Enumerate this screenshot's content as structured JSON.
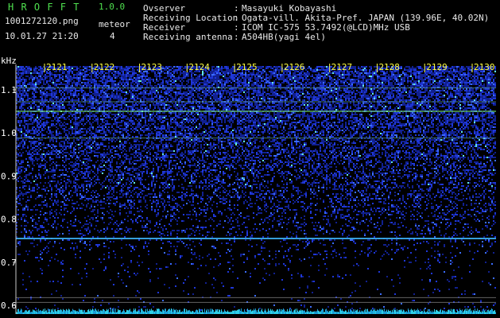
{
  "header": {
    "app_name": "H R O F F T",
    "version": "1.0.0",
    "filename": "1001272120.png",
    "datetime": "10.01.27 21:20",
    "meteor_label": "meteor",
    "meteor_count": "4",
    "info_labels": [
      "Ovserver",
      "Receiving Location",
      "Receiver",
      "Receiving antenna"
    ],
    "info_separators": [
      ":",
      ":",
      ":",
      ":"
    ],
    "info_values": [
      "Masayuki Kobayashi",
      "Ogata-vill. Akita-Pref. JAPAN (139.96E, 40.02N)",
      "ICOM IC-575 53.7492(@LCD)MHz USB",
      "A504HB(yagi 4el)"
    ]
  },
  "spectrogram": {
    "unit": "kHz",
    "time_ticks": [
      "2121",
      "2122",
      "2123",
      "2124",
      "2125",
      "2126",
      "2127",
      "2128",
      "2129",
      "2130"
    ],
    "freq_ticks": [
      "1.1",
      "1.0",
      "0.9",
      "0.8",
      "0.7",
      "0.6"
    ],
    "freq_values": [
      1.1,
      1.0,
      0.9,
      0.8,
      0.7,
      0.6
    ],
    "freq_range": [
      0.58,
      1.155
    ],
    "carrier_lines_khz": [
      1.05,
      0.755
    ],
    "faint_lines_khz": [
      1.104,
      1.072,
      0.988,
      0.618,
      0.607
    ],
    "colors": {
      "background": "#000000",
      "header_green": "#4fe04f",
      "tick_yellow": "#ffff40",
      "noise_blue": "#1a2fd0",
      "carrier_cyan": "#3fb8ff",
      "carrier_green": "#7af07a"
    }
  }
}
